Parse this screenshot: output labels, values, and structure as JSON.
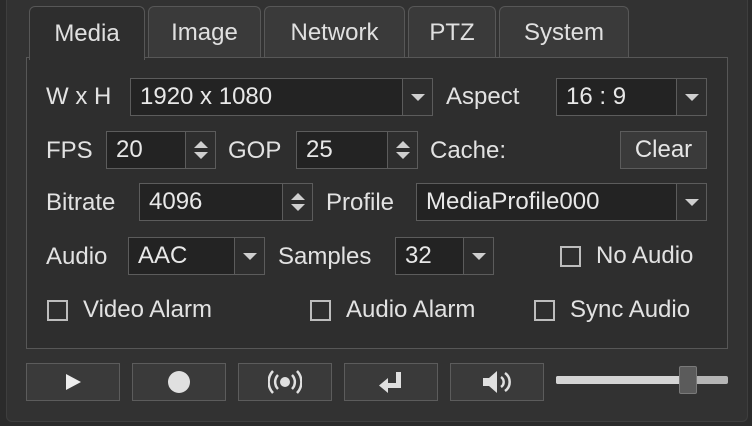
{
  "tabs": [
    {
      "label": "Media",
      "active": true
    },
    {
      "label": "Image",
      "active": false
    },
    {
      "label": "Network",
      "active": false
    },
    {
      "label": "PTZ",
      "active": false
    },
    {
      "label": "System",
      "active": false
    }
  ],
  "media": {
    "resolution": {
      "label": "W x H",
      "value": "1920 x 1080"
    },
    "aspect": {
      "label": "Aspect",
      "value": "16 : 9"
    },
    "fps": {
      "label": "FPS",
      "value": "20"
    },
    "gop": {
      "label": "GOP",
      "value": "25"
    },
    "cache": {
      "label": "Cache:",
      "button_label": "Clear"
    },
    "bitrate": {
      "label": "Bitrate",
      "value": "4096"
    },
    "profile": {
      "label": "Profile",
      "value": "MediaProfile000"
    },
    "audio": {
      "label": "Audio",
      "value": "AAC"
    },
    "samples": {
      "label": "Samples",
      "value": "32"
    },
    "no_audio": {
      "label": "No Audio",
      "checked": false
    },
    "video_alarm": {
      "label": "Video Alarm",
      "checked": false
    },
    "audio_alarm": {
      "label": "Audio Alarm",
      "checked": false
    },
    "sync_audio": {
      "label": "Sync Audio",
      "checked": false
    }
  },
  "toolbar": {
    "buttons": [
      {
        "name": "play-button",
        "icon": "play-icon"
      },
      {
        "name": "record-button",
        "icon": "record-icon"
      },
      {
        "name": "broadcast-button",
        "icon": "broadcast-icon"
      },
      {
        "name": "return-button",
        "icon": "return-icon"
      },
      {
        "name": "volume-button",
        "icon": "speaker-icon"
      }
    ],
    "volume_level": 0.77
  },
  "colors": {
    "background": "#2b2b2b",
    "panel": "#2e2e2e",
    "border": "#575757",
    "text": "#e2e2e2"
  }
}
